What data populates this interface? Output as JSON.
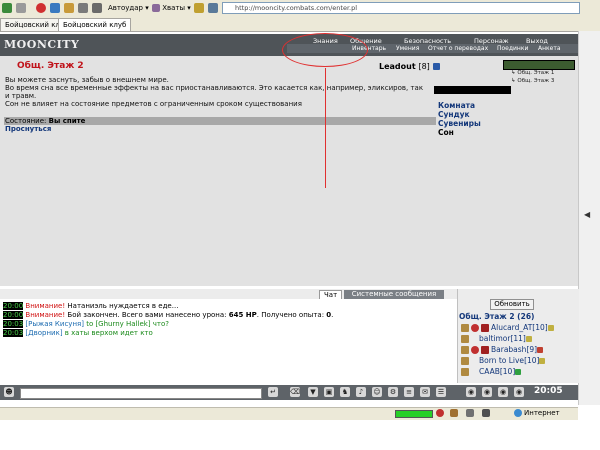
{
  "browser": {
    "toolbar": {
      "back_label": "",
      "autoudar_label": "Автоудар",
      "hvaty_label": "Хваты",
      "address": "http://mooncity.combats.com/enter.pl"
    },
    "tabs": [
      {
        "label": "Бойцовский клуб"
      },
      {
        "label": "Бойцовский клуб"
      }
    ],
    "status": {
      "zone": "Интернет"
    }
  },
  "header": {
    "logo": "MOONCITY",
    "menu_top": [
      "Знания",
      "Общение",
      "Безопасность",
      "Персонаж",
      "Выход"
    ],
    "menu_bottom": [
      "Инвентарь",
      "Умения",
      "Отчет о переводах",
      "Поединки",
      "Анкета"
    ]
  },
  "room": {
    "title": "Общ. Этаж 2",
    "leader_name": "Leadout",
    "leader_level": "[8]",
    "info_lines": [
      "Вы можете заснуть, забыв о внешнем мире.",
      "Во время сна все временные эффекты на вас приостанавливаются. Это касается как, например, эликсиров, так",
      "и травм.",
      "Сон не влияет на состояние предметов с ограниченным сроком существования"
    ],
    "state_label": "Состояние:",
    "state_value": "Вы спите",
    "wake_link": "Проснуться",
    "nav_links": [
      "Комната",
      "Сундук",
      "Сувениры",
      "Сон"
    ],
    "floors": [
      "Общ. Этаж 1",
      "Общ. Этаж 3"
    ]
  },
  "chat": {
    "tabs": [
      "Чат",
      "Системные сообщения"
    ],
    "lines": [
      {
        "time": "20:00",
        "prefix": "Внимание!",
        "text": " Натаниэль нуждается в еде..."
      },
      {
        "time": "20:00",
        "prefix": "Внимание!",
        "text": " Бой закончен. Всего вами нанесено урона: ",
        "bold1": "645 HP",
        "text2": ". Получено опыта: ",
        "bold2": "0",
        "text3": "."
      },
      {
        "time": "20:03",
        "nick": "[Рыжая Кисуня]",
        "text": " to [Ghurny Hallek] что?"
      },
      {
        "time": "20:03",
        "nick": "[Дворник]",
        "text": " в хаты верхом идет кто"
      }
    ]
  },
  "users": {
    "refresh_label": "Обновить",
    "count_label": "Общ. Этаж 2 (26)",
    "list": [
      {
        "name": "Alucard_AT",
        "level": "[10]"
      },
      {
        "name": "baltimor",
        "level": "[11]"
      },
      {
        "name": "Barabash",
        "level": "[9]"
      },
      {
        "name": "Born to Live",
        "level": "[10]"
      },
      {
        "name": "CAAB",
        "level": "[10]"
      }
    ]
  },
  "bottom": {
    "clock": "20:05"
  },
  "colors": {
    "header_bg": "#4f5458",
    "title_red": "#c0141b",
    "link_blue": "#13377a",
    "annotation_red": "#e03030"
  }
}
